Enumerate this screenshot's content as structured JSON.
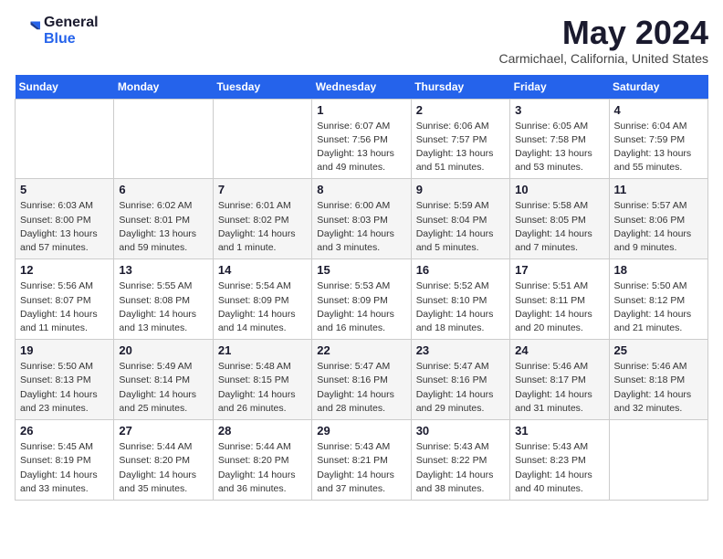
{
  "header": {
    "logo_general": "General",
    "logo_blue": "Blue",
    "month_title": "May 2024",
    "location": "Carmichael, California, United States"
  },
  "days_of_week": [
    "Sunday",
    "Monday",
    "Tuesday",
    "Wednesday",
    "Thursday",
    "Friday",
    "Saturday"
  ],
  "weeks": [
    [
      {
        "day": "",
        "info": ""
      },
      {
        "day": "",
        "info": ""
      },
      {
        "day": "",
        "info": ""
      },
      {
        "day": "1",
        "info": "Sunrise: 6:07 AM\nSunset: 7:56 PM\nDaylight: 13 hours\nand 49 minutes."
      },
      {
        "day": "2",
        "info": "Sunrise: 6:06 AM\nSunset: 7:57 PM\nDaylight: 13 hours\nand 51 minutes."
      },
      {
        "day": "3",
        "info": "Sunrise: 6:05 AM\nSunset: 7:58 PM\nDaylight: 13 hours\nand 53 minutes."
      },
      {
        "day": "4",
        "info": "Sunrise: 6:04 AM\nSunset: 7:59 PM\nDaylight: 13 hours\nand 55 minutes."
      }
    ],
    [
      {
        "day": "5",
        "info": "Sunrise: 6:03 AM\nSunset: 8:00 PM\nDaylight: 13 hours\nand 57 minutes."
      },
      {
        "day": "6",
        "info": "Sunrise: 6:02 AM\nSunset: 8:01 PM\nDaylight: 13 hours\nand 59 minutes."
      },
      {
        "day": "7",
        "info": "Sunrise: 6:01 AM\nSunset: 8:02 PM\nDaylight: 14 hours\nand 1 minute."
      },
      {
        "day": "8",
        "info": "Sunrise: 6:00 AM\nSunset: 8:03 PM\nDaylight: 14 hours\nand 3 minutes."
      },
      {
        "day": "9",
        "info": "Sunrise: 5:59 AM\nSunset: 8:04 PM\nDaylight: 14 hours\nand 5 minutes."
      },
      {
        "day": "10",
        "info": "Sunrise: 5:58 AM\nSunset: 8:05 PM\nDaylight: 14 hours\nand 7 minutes."
      },
      {
        "day": "11",
        "info": "Sunrise: 5:57 AM\nSunset: 8:06 PM\nDaylight: 14 hours\nand 9 minutes."
      }
    ],
    [
      {
        "day": "12",
        "info": "Sunrise: 5:56 AM\nSunset: 8:07 PM\nDaylight: 14 hours\nand 11 minutes."
      },
      {
        "day": "13",
        "info": "Sunrise: 5:55 AM\nSunset: 8:08 PM\nDaylight: 14 hours\nand 13 minutes."
      },
      {
        "day": "14",
        "info": "Sunrise: 5:54 AM\nSunset: 8:09 PM\nDaylight: 14 hours\nand 14 minutes."
      },
      {
        "day": "15",
        "info": "Sunrise: 5:53 AM\nSunset: 8:09 PM\nDaylight: 14 hours\nand 16 minutes."
      },
      {
        "day": "16",
        "info": "Sunrise: 5:52 AM\nSunset: 8:10 PM\nDaylight: 14 hours\nand 18 minutes."
      },
      {
        "day": "17",
        "info": "Sunrise: 5:51 AM\nSunset: 8:11 PM\nDaylight: 14 hours\nand 20 minutes."
      },
      {
        "day": "18",
        "info": "Sunrise: 5:50 AM\nSunset: 8:12 PM\nDaylight: 14 hours\nand 21 minutes."
      }
    ],
    [
      {
        "day": "19",
        "info": "Sunrise: 5:50 AM\nSunset: 8:13 PM\nDaylight: 14 hours\nand 23 minutes."
      },
      {
        "day": "20",
        "info": "Sunrise: 5:49 AM\nSunset: 8:14 PM\nDaylight: 14 hours\nand 25 minutes."
      },
      {
        "day": "21",
        "info": "Sunrise: 5:48 AM\nSunset: 8:15 PM\nDaylight: 14 hours\nand 26 minutes."
      },
      {
        "day": "22",
        "info": "Sunrise: 5:47 AM\nSunset: 8:16 PM\nDaylight: 14 hours\nand 28 minutes."
      },
      {
        "day": "23",
        "info": "Sunrise: 5:47 AM\nSunset: 8:16 PM\nDaylight: 14 hours\nand 29 minutes."
      },
      {
        "day": "24",
        "info": "Sunrise: 5:46 AM\nSunset: 8:17 PM\nDaylight: 14 hours\nand 31 minutes."
      },
      {
        "day": "25",
        "info": "Sunrise: 5:46 AM\nSunset: 8:18 PM\nDaylight: 14 hours\nand 32 minutes."
      }
    ],
    [
      {
        "day": "26",
        "info": "Sunrise: 5:45 AM\nSunset: 8:19 PM\nDaylight: 14 hours\nand 33 minutes."
      },
      {
        "day": "27",
        "info": "Sunrise: 5:44 AM\nSunset: 8:20 PM\nDaylight: 14 hours\nand 35 minutes."
      },
      {
        "day": "28",
        "info": "Sunrise: 5:44 AM\nSunset: 8:20 PM\nDaylight: 14 hours\nand 36 minutes."
      },
      {
        "day": "29",
        "info": "Sunrise: 5:43 AM\nSunset: 8:21 PM\nDaylight: 14 hours\nand 37 minutes."
      },
      {
        "day": "30",
        "info": "Sunrise: 5:43 AM\nSunset: 8:22 PM\nDaylight: 14 hours\nand 38 minutes."
      },
      {
        "day": "31",
        "info": "Sunrise: 5:43 AM\nSunset: 8:23 PM\nDaylight: 14 hours\nand 40 minutes."
      },
      {
        "day": "",
        "info": ""
      }
    ]
  ]
}
